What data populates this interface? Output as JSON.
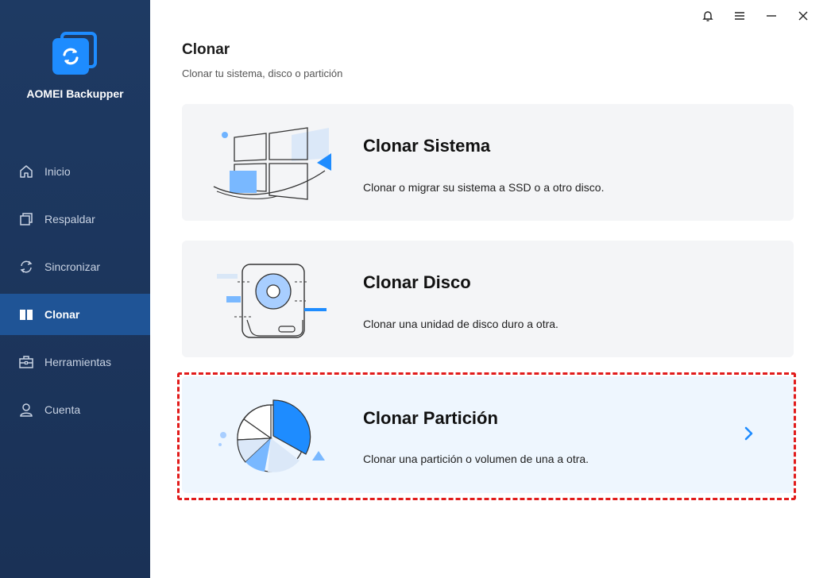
{
  "app": {
    "name": "AOMEI Backupper"
  },
  "sidebar": {
    "items": [
      {
        "label": "Inicio",
        "icon": "home-icon"
      },
      {
        "label": "Respaldar",
        "icon": "backup-icon"
      },
      {
        "label": "Sincronizar",
        "icon": "sync-icon"
      },
      {
        "label": "Clonar",
        "icon": "clone-icon",
        "active": true
      },
      {
        "label": "Herramientas",
        "icon": "toolbox-icon"
      },
      {
        "label": "Cuenta",
        "icon": "user-icon"
      }
    ]
  },
  "window_controls": [
    "bell-icon",
    "menu-icon",
    "minimize-icon",
    "close-icon"
  ],
  "main": {
    "title": "Clonar",
    "subtitle": "Clonar tu sistema, disco o partición",
    "cards": [
      {
        "title": "Clonar Sistema",
        "description": "Clonar o migrar su sistema a SSD o a otro disco.",
        "icon": "windows-clone-illustration"
      },
      {
        "title": "Clonar Disco",
        "description": "Clonar una unidad de disco duro a otra.",
        "icon": "disk-clone-illustration"
      },
      {
        "title": "Clonar Partición",
        "description": "Clonar una partición o volumen de una a otra.",
        "icon": "partition-clone-illustration",
        "highlighted": true
      }
    ]
  },
  "colors": {
    "sidebar_bg": "#1e3a63",
    "sidebar_active": "#1f5496",
    "accent": "#1e8cff",
    "highlight_border": "#e11b1b"
  }
}
